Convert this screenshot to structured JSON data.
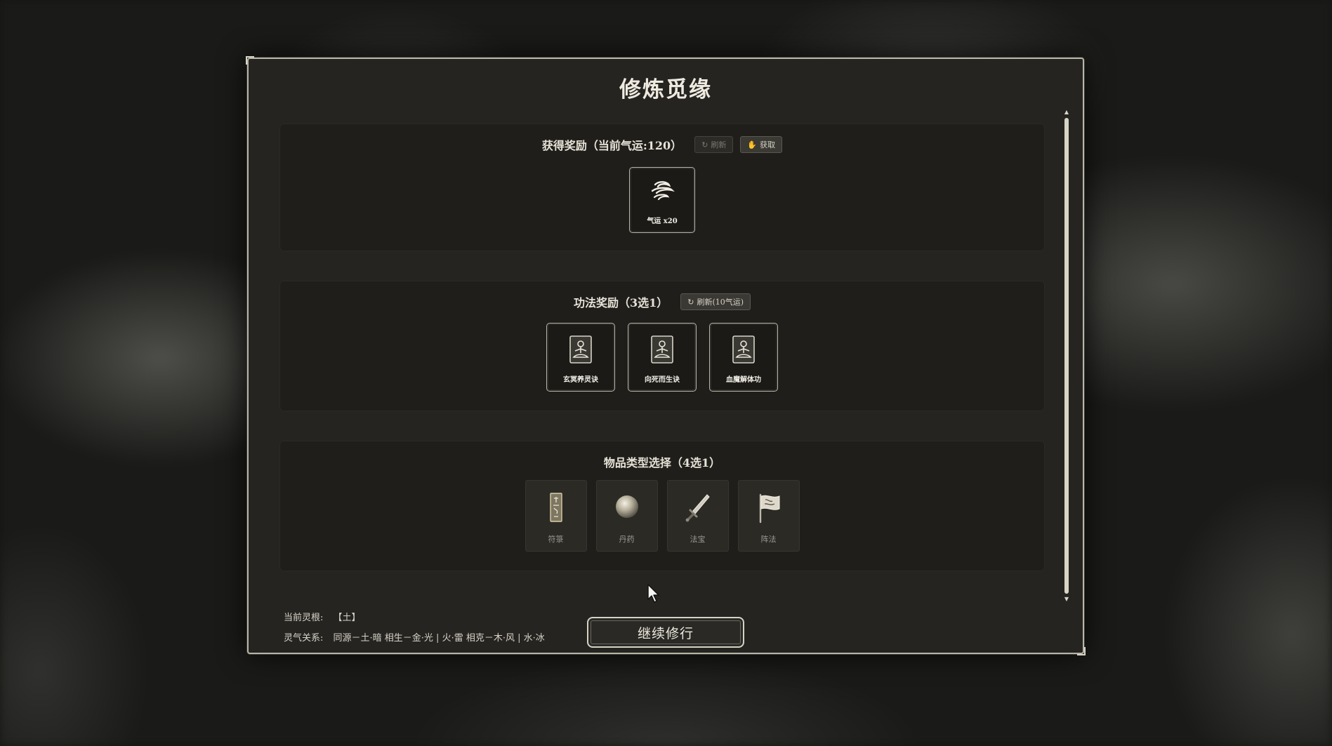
{
  "dialog": {
    "title": "修炼觅缘"
  },
  "reward_section": {
    "title": "获得奖励（当前气运:120）",
    "refresh_label": "刷新",
    "claim_label": "获取",
    "item": {
      "icon": "qiyun-swirl-icon",
      "label": "气运 x20"
    }
  },
  "technique_section": {
    "title": "功法奖励（3选1）",
    "refresh_label": "刷新(10气运)",
    "cards": [
      {
        "icon": "meditating-figure-icon",
        "label": "玄冥养灵诀"
      },
      {
        "icon": "meditating-figure-icon",
        "label": "向死而生诀"
      },
      {
        "icon": "meditating-figure-icon",
        "label": "血魔解体功"
      }
    ]
  },
  "item_type_section": {
    "title": "物品类型选择（4选1）",
    "tiles": [
      {
        "icon": "talisman-icon",
        "label": "符箓"
      },
      {
        "icon": "pill-icon",
        "label": "丹药"
      },
      {
        "icon": "sword-icon",
        "label": "法宝"
      },
      {
        "icon": "flag-icon",
        "label": "阵法"
      }
    ]
  },
  "footer": {
    "root_label": "当前灵根:",
    "root_value": "【土】",
    "relation_label": "灵气关系:",
    "relation_value": "同源－土·暗  相生－金·光 | 火·雷  相克－木·风 | 水·冰"
  },
  "continue_button": {
    "label": "继续修行"
  },
  "scroll": {
    "position": 0.0,
    "visible_fraction": 1.0
  }
}
